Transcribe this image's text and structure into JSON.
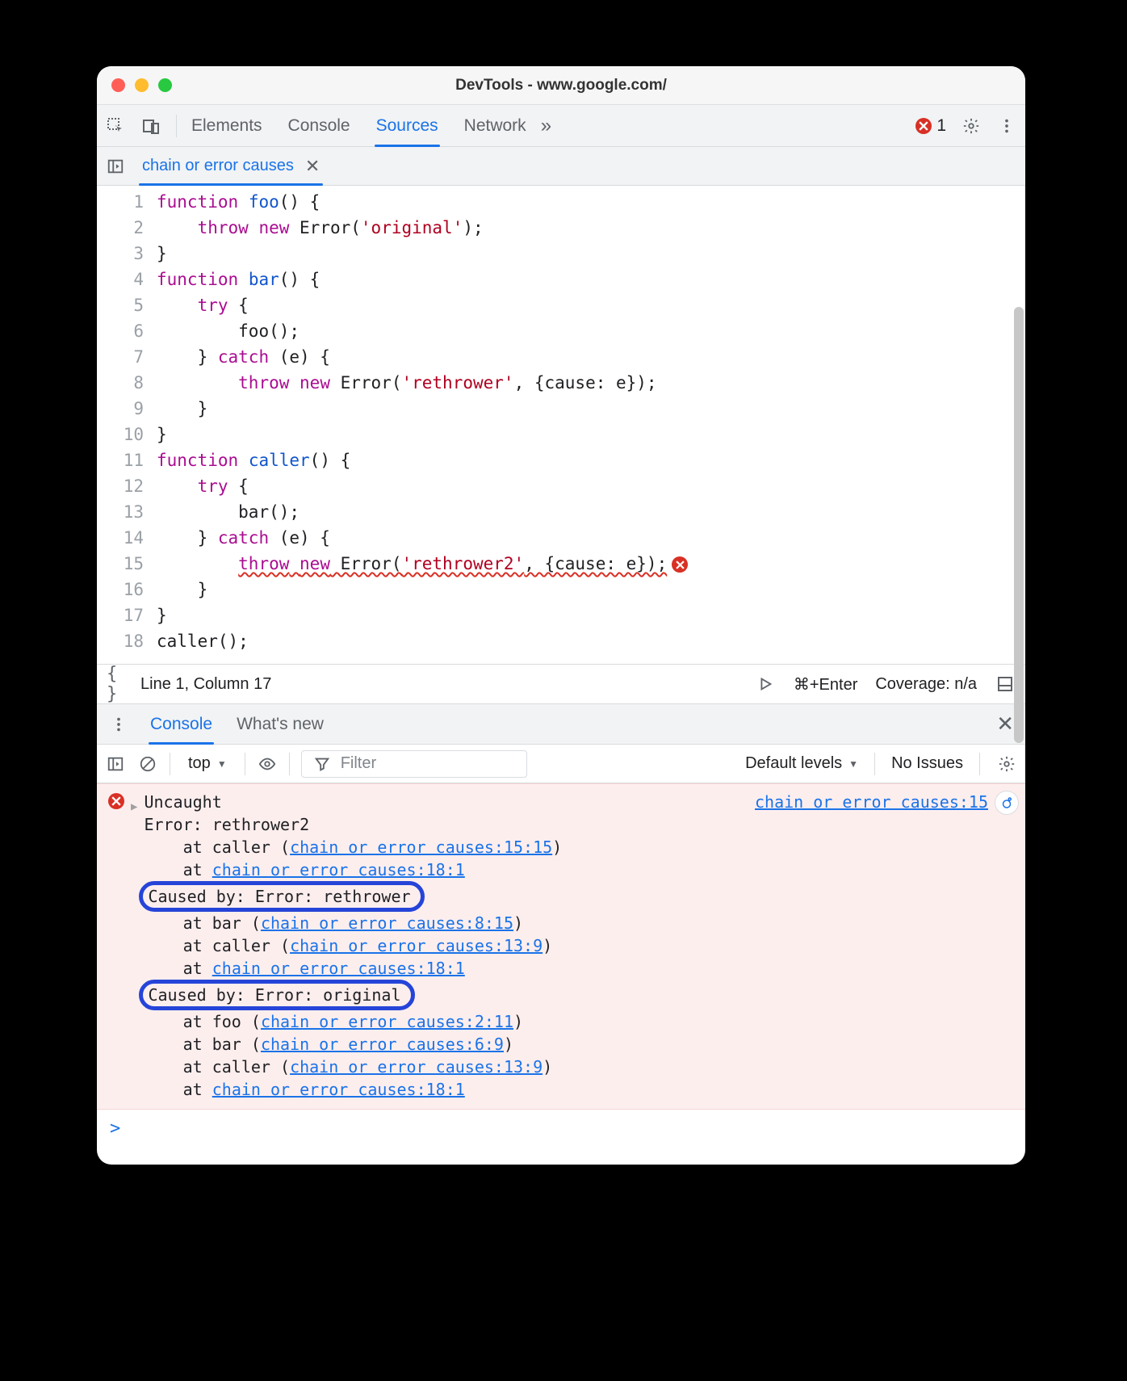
{
  "window": {
    "title": "DevTools - www.google.com/"
  },
  "toolbar": {
    "tabs": [
      "Elements",
      "Console",
      "Sources",
      "Network"
    ],
    "active_tab_index": 2,
    "overflow_glyph": "»",
    "error_count": "1"
  },
  "file_tabs": {
    "items": [
      {
        "label": "chain or error causes"
      }
    ]
  },
  "editor": {
    "lines": [
      {
        "n": "1",
        "ind": 0,
        "segs": [
          [
            "kw",
            "function"
          ],
          [
            "",
            " "
          ],
          [
            "fn",
            "foo"
          ],
          [
            "",
            "() {"
          ]
        ]
      },
      {
        "n": "2",
        "ind": 1,
        "segs": [
          [
            "kw",
            "throw"
          ],
          [
            "",
            " "
          ],
          [
            "kw",
            "new"
          ],
          [
            "",
            " Error("
          ],
          [
            "str",
            "'original'"
          ],
          [
            "",
            ");"
          ]
        ]
      },
      {
        "n": "3",
        "ind": 0,
        "segs": [
          [
            "",
            "}"
          ]
        ]
      },
      {
        "n": "4",
        "ind": 0,
        "segs": [
          [
            "kw",
            "function"
          ],
          [
            "",
            " "
          ],
          [
            "fn",
            "bar"
          ],
          [
            "",
            "() {"
          ]
        ]
      },
      {
        "n": "5",
        "ind": 1,
        "segs": [
          [
            "kw",
            "try"
          ],
          [
            "",
            " {"
          ]
        ]
      },
      {
        "n": "6",
        "ind": 2,
        "segs": [
          [
            "",
            "foo();"
          ]
        ]
      },
      {
        "n": "7",
        "ind": 1,
        "segs": [
          [
            "",
            "} "
          ],
          [
            "kw",
            "catch"
          ],
          [
            "",
            " (e) {"
          ]
        ]
      },
      {
        "n": "8",
        "ind": 2,
        "segs": [
          [
            "kw",
            "throw"
          ],
          [
            "",
            " "
          ],
          [
            "kw",
            "new"
          ],
          [
            "",
            " Error("
          ],
          [
            "str",
            "'rethrower'"
          ],
          [
            "",
            ", {cause: e});"
          ]
        ]
      },
      {
        "n": "9",
        "ind": 1,
        "segs": [
          [
            "",
            "}"
          ]
        ]
      },
      {
        "n": "10",
        "ind": 0,
        "segs": [
          [
            "",
            "}"
          ]
        ]
      },
      {
        "n": "11",
        "ind": 0,
        "segs": [
          [
            "kw",
            "function"
          ],
          [
            "",
            " "
          ],
          [
            "fn",
            "caller"
          ],
          [
            "",
            "() {"
          ]
        ]
      },
      {
        "n": "12",
        "ind": 1,
        "segs": [
          [
            "kw",
            "try"
          ],
          [
            "",
            " {"
          ]
        ]
      },
      {
        "n": "13",
        "ind": 2,
        "segs": [
          [
            "",
            "bar();"
          ]
        ]
      },
      {
        "n": "14",
        "ind": 1,
        "segs": [
          [
            "",
            "} "
          ],
          [
            "kw",
            "catch"
          ],
          [
            "",
            " (e) {"
          ]
        ]
      },
      {
        "n": "15",
        "ind": 2,
        "err": true,
        "segs": [
          [
            "kw",
            "throw"
          ],
          [
            "",
            " "
          ],
          [
            "kw",
            "new"
          ],
          [
            "",
            " Error("
          ],
          [
            "str",
            "'rethrower2'"
          ],
          [
            "",
            ", {cause: e});"
          ]
        ]
      },
      {
        "n": "16",
        "ind": 1,
        "segs": [
          [
            "",
            "}"
          ]
        ]
      },
      {
        "n": "17",
        "ind": 0,
        "segs": [
          [
            "",
            "}"
          ]
        ]
      },
      {
        "n": "18",
        "ind": 0,
        "segs": [
          [
            "",
            "caller();"
          ]
        ]
      }
    ]
  },
  "statusbar": {
    "position": "Line 1, Column 17",
    "shortcut": "⌘+Enter",
    "coverage": "Coverage: n/a"
  },
  "drawer": {
    "tabs": [
      "Console",
      "What's new"
    ],
    "active_tab_index": 0
  },
  "console_toolbar": {
    "context": "top",
    "filter_placeholder": "Filter",
    "levels": "Default levels",
    "issues": "No Issues"
  },
  "console": {
    "source_link": "chain or error causes:15",
    "entries": [
      {
        "type": "head",
        "text": "Uncaught"
      },
      {
        "type": "line",
        "text": "Error: rethrower2"
      },
      {
        "type": "stack",
        "pre": "    at caller (",
        "link": "chain or error causes:15:15",
        "post": ")"
      },
      {
        "type": "stack",
        "pre": "    at ",
        "link": "chain or error causes:18:1",
        "post": ""
      },
      {
        "type": "cause",
        "text": "Caused by: Error: rethrower"
      },
      {
        "type": "stack",
        "pre": "    at bar (",
        "link": "chain or error causes:8:15",
        "post": ")"
      },
      {
        "type": "stack",
        "pre": "    at caller (",
        "link": "chain or error causes:13:9",
        "post": ")"
      },
      {
        "type": "stack",
        "pre": "    at ",
        "link": "chain or error causes:18:1",
        "post": ""
      },
      {
        "type": "cause",
        "text": "Caused by: Error: original"
      },
      {
        "type": "stack",
        "pre": "    at foo (",
        "link": "chain or error causes:2:11",
        "post": ")"
      },
      {
        "type": "stack",
        "pre": "    at bar (",
        "link": "chain or error causes:6:9",
        "post": ")"
      },
      {
        "type": "stack",
        "pre": "    at caller (",
        "link": "chain or error causes:13:9",
        "post": ")"
      },
      {
        "type": "stack",
        "pre": "    at ",
        "link": "chain or error causes:18:1",
        "post": ""
      }
    ]
  },
  "glyphs": {
    "triangle_down": "▼",
    "triangle_right": "▶",
    "chevrons": "»",
    "prompt": ">"
  }
}
